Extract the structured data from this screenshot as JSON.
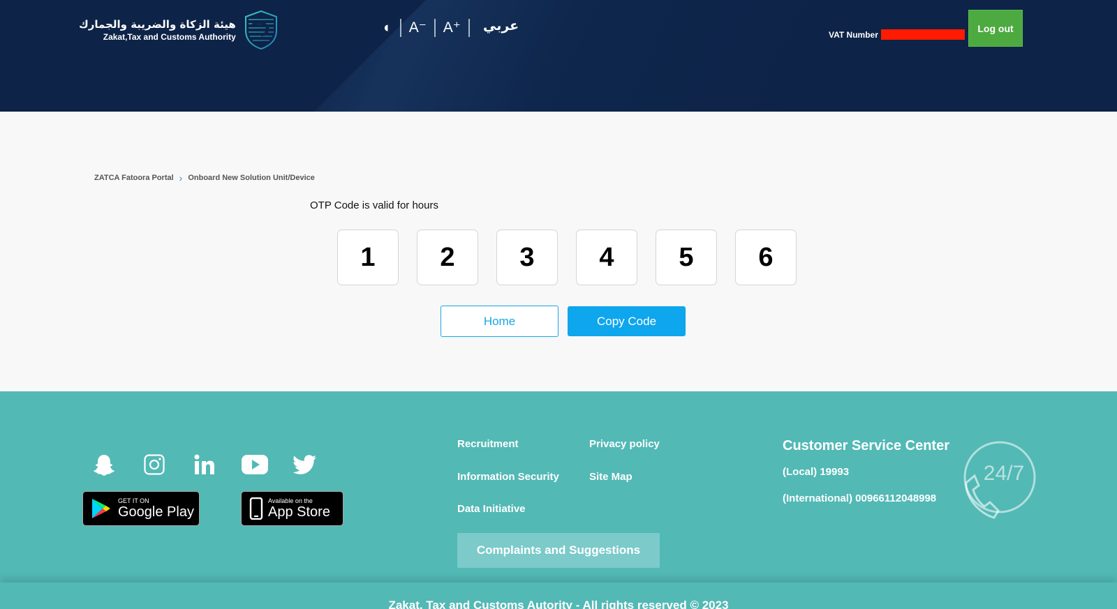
{
  "header": {
    "logo": {
      "arabic_name": "هيئة الزكاة والضريبة والجمارك",
      "english_name": "Zakat,Tax and Customs Authority"
    },
    "tools": {
      "contrast_glyph": "◐",
      "decrease_font_label": "A⁻",
      "increase_font_label": "A⁺"
    },
    "language_label": "عربي",
    "vat_label": "VAT Number",
    "logout_label": "Log out"
  },
  "breadcrumb": {
    "items": [
      "ZATCA Fatoora Portal",
      "Onboard New Solution Unit/Device"
    ]
  },
  "otp": {
    "title": "OTP Code is valid for hours",
    "digits": [
      "1",
      "2",
      "3",
      "4",
      "5",
      "6"
    ]
  },
  "actions": {
    "home_label": "Home",
    "copy_label": "Copy Code"
  },
  "footer": {
    "social_icons": [
      "snapchat-icon",
      "instagram-icon",
      "linkedin-icon",
      "youtube-icon",
      "twitter-icon"
    ],
    "google_play": {
      "small": "GET IT ON",
      "big": "Google Play"
    },
    "app_store": {
      "small": "Available on the",
      "big": "App Store"
    },
    "links": {
      "recruitment": "Recruitment",
      "privacy": "Privacy policy",
      "info_security": "Information Security",
      "site_map": "Site Map",
      "data_initiative": "Data Initiative"
    },
    "complaints_label": "Complaints and Suggestions",
    "customer_service": {
      "title": "Customer Service Center",
      "local": "(Local) 19993",
      "international": "(International) 00966112048998",
      "badge": "24/7"
    },
    "copyright": "Zakat, Tax and Customs Autority - All rights reserved © 2023"
  },
  "colors": {
    "header_bg": "#0d2347",
    "logout_green": "#4caa40",
    "accent_blue": "#0ea6ec",
    "footer_teal": "#52b9b5",
    "redaction_red": "#ff1a00"
  }
}
